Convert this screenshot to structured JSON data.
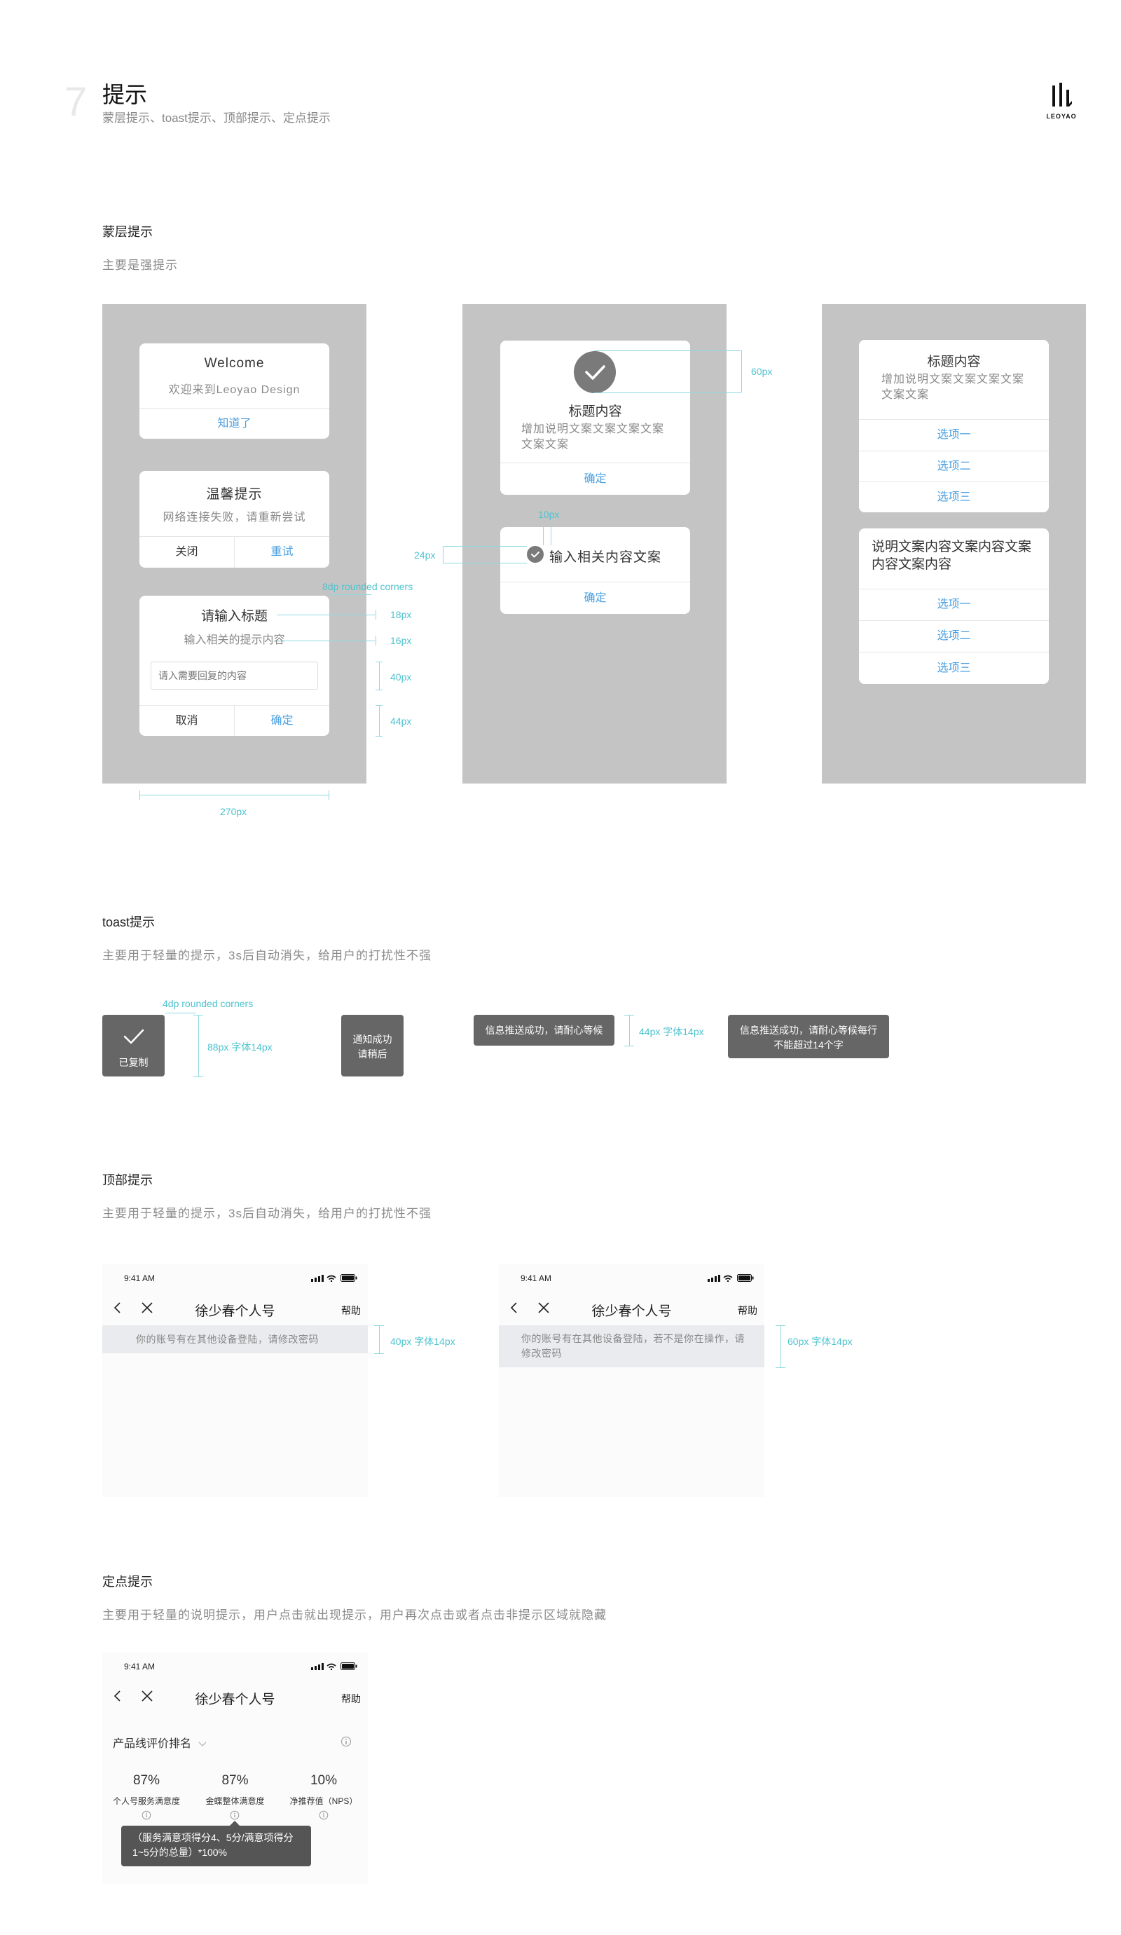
{
  "header": {
    "number": "7",
    "title": "提示",
    "subtitle": "蒙层提示、toast提示、顶部提示、定点提示",
    "logo_text": "LEOYAO"
  },
  "section1": {
    "title": "蒙层提示",
    "desc": "主要是强提示",
    "welcome": {
      "title": "Welcome",
      "body": "欢迎来到Leoyao Design",
      "button": "知道了"
    },
    "warm": {
      "title": "温馨提示",
      "body": "网络连接失败，请重新尝试",
      "close": "关闭",
      "retry": "重试"
    },
    "input": {
      "title": "请输入标题",
      "body": "输入相关的提示内容",
      "placeholder": "请入需要回复的内容",
      "cancel": "取消",
      "confirm": "确定"
    },
    "ann_rounded": "8dp rounded corners",
    "ann_18": "18px",
    "ann_16": "16px",
    "ann_40": "40px",
    "ann_44": "44px",
    "ann_270": "270px",
    "success": {
      "title": "标题内容",
      "body": "增加说明文案文案文案文案文案文案",
      "button": "确定"
    },
    "ann_60": "60px",
    "ann_10": "10px",
    "ann_24": "24px",
    "check_input": {
      "text": "输入相关内容文案",
      "button": "确定"
    },
    "options1": {
      "title": "标题内容",
      "body": "增加说明文案文案文案文案文案文案",
      "items": [
        "选项一",
        "选项二",
        "选项三"
      ]
    },
    "options2": {
      "title": "说明文案内容文案内容文案内容文案内容",
      "items": [
        "选项一",
        "选项二",
        "选项三"
      ]
    }
  },
  "section2": {
    "title": "toast提示",
    "desc": "主要用于轻量的提示，3s后自动消失，给用户的打扰性不强",
    "ann_rounded": "4dp rounded corners",
    "copied": "已复制",
    "ann_88": "88px 字体14px",
    "notify_line1": "通知成功",
    "notify_line2": "请稍后",
    "push1": "信息推送成功，请耐心等候",
    "ann_44": "44px 字体14px",
    "push2_line1": "信息推送成功，请耐心等候每行",
    "push2_line2": "不能超过14个字"
  },
  "section3": {
    "title": "顶部提示",
    "desc": "主要用于轻量的提示，3s后自动消失，给用户的打扰性不强",
    "time": "9:41 AM",
    "nav_title": "徐少春个人号",
    "help": "帮助",
    "notice1": "你的账号有在其他设备登陆，请修改密码",
    "ann_40": "40px 字体14px",
    "notice2": "你的账号有在其他设备登陆，若不是你在操作，请修改密码",
    "ann_60": "60px 字体14px"
  },
  "section4": {
    "title": "定点提示",
    "desc": "主要用于轻量的说明提示，用户点击就出现提示，用户再次点击或者点击非提示区域就隐藏",
    "time": "9:41 AM",
    "nav_title": "徐少春个人号",
    "help": "帮助",
    "rank_title": "产品线评价排名",
    "stats": [
      {
        "value": "87%",
        "label": "个人号服务满意度"
      },
      {
        "value": "87%",
        "label": "金蝶整体满意度"
      },
      {
        "value": "10%",
        "label": "净推荐值（NPS）"
      }
    ],
    "tooltip": "（服务满意项得分4、5分/满意项得分1~5分的总量）*100%"
  }
}
